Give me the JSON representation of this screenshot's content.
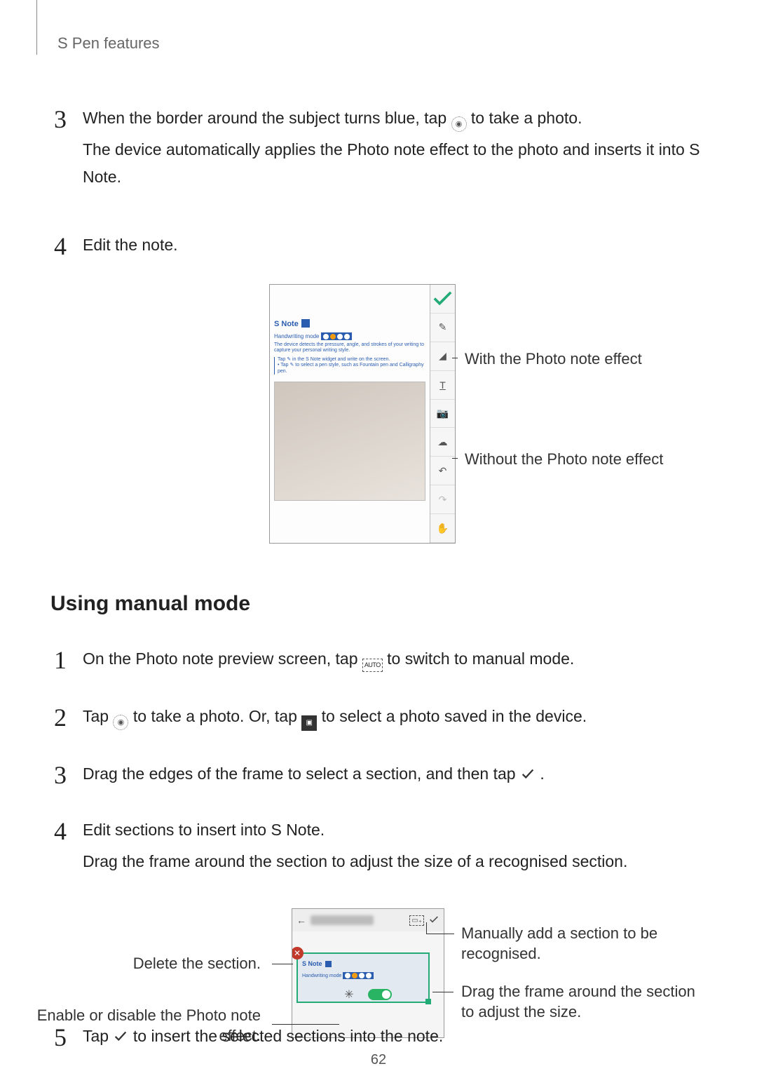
{
  "header": {
    "section_title": "S Pen features"
  },
  "steps": {
    "s3": {
      "num": "3",
      "line1a": "When the border around the subject turns blue, tap ",
      "line1b": " to take a photo.",
      "line2": "The device automatically applies the Photo note effect to the photo and inserts it into S Note."
    },
    "s4": {
      "num": "4",
      "text": "Edit the note."
    }
  },
  "fig1": {
    "snote": "S Note",
    "hw": "Handwriting mode",
    "desc": "The device detects the pressure, angle, and strokes of your writing to capture your personal writing style.",
    "bullets": "Tap ✎ in the S Note widget and write on the screen.\n• Tap ✎ to select a pen style, such as Fountain pen and Calligraphy pen.",
    "callout_with": "With the Photo note effect",
    "callout_without": "Without the Photo note effect"
  },
  "heading2": "Using manual mode",
  "manual": {
    "m1": {
      "num": "1",
      "a": "On the Photo note preview screen, tap ",
      "b": " to switch to manual mode.",
      "auto": "AUTO"
    },
    "m2": {
      "num": "2",
      "a": "Tap ",
      "b": " to take a photo. Or, tap ",
      "c": " to select a photo saved in the device."
    },
    "m3": {
      "num": "3",
      "a": "Drag the edges of the frame to select a section, and then tap ",
      "b": "."
    },
    "m4": {
      "num": "4",
      "a": "Edit sections to insert into S Note.",
      "b": "Drag the frame around the section to adjust the size of a recognised section."
    },
    "m5": {
      "num": "5",
      "a": "Tap ",
      "b": " to insert the selected sections into the note."
    }
  },
  "fig2": {
    "snote": "S Note",
    "hw": "Handwriting mode",
    "callout_add": "Manually add a section to be recognised.",
    "callout_drag": "Drag the frame around the section to adjust the size.",
    "callout_delete": "Delete the section.",
    "callout_toggle": "Enable or disable the Photo note effect."
  },
  "page_number": "62"
}
